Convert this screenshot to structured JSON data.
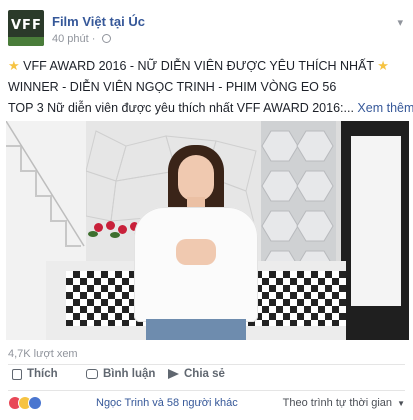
{
  "post": {
    "page_name": "Film Việt tại Úc",
    "time": "40 phút",
    "separator": "·",
    "avatar_text": "VFF",
    "lines": {
      "line1": "VFF AWARD 2016 - NỮ DIỄN VIÊN ĐƯỢC YÊU THÍCH NHẤT",
      "line2": "WINNER - DIỄN VIÊN NGỌC TRINH - PHIM VÒNG EO 56",
      "line3": "TOP 3 Nữ diễn viên được yêu thích nhất VFF AWARD 2016:...",
      "see_more": "Xem thêm",
      "star": "★"
    }
  },
  "stats": {
    "views": "4,7K lượt xem"
  },
  "actions": {
    "like": "Thích",
    "comment": "Bình luận",
    "share": "Chia sẻ"
  },
  "reactions": {
    "summary": "Ngọc Trinh và 58 người khác",
    "sort": "Theo trình tự thời gian",
    "sort_caret": "▼"
  },
  "icons": {
    "globe": "globe-icon",
    "chevron": "chevron-down-icon"
  },
  "colors": {
    "link": "#365899",
    "meta": "#90949c",
    "text": "#1d2129"
  }
}
